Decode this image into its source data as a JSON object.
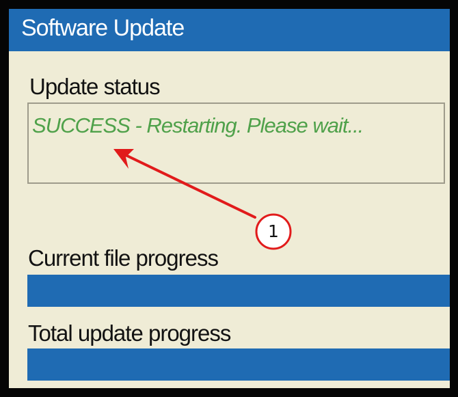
{
  "window": {
    "title": "Software Update"
  },
  "update_status": {
    "label": "Update status",
    "message": "SUCCESS - Restarting. Please wait..."
  },
  "current_file_progress": {
    "label": "Current file progress",
    "percent": 100
  },
  "total_update_progress": {
    "label": "Total update progress",
    "percent": 100
  },
  "callout": {
    "number": "1"
  },
  "colors": {
    "window_accent": "#1f6bb3",
    "window_background": "#efecd6",
    "success_text": "#4fa14a",
    "callout_red": "#e11b1b"
  }
}
